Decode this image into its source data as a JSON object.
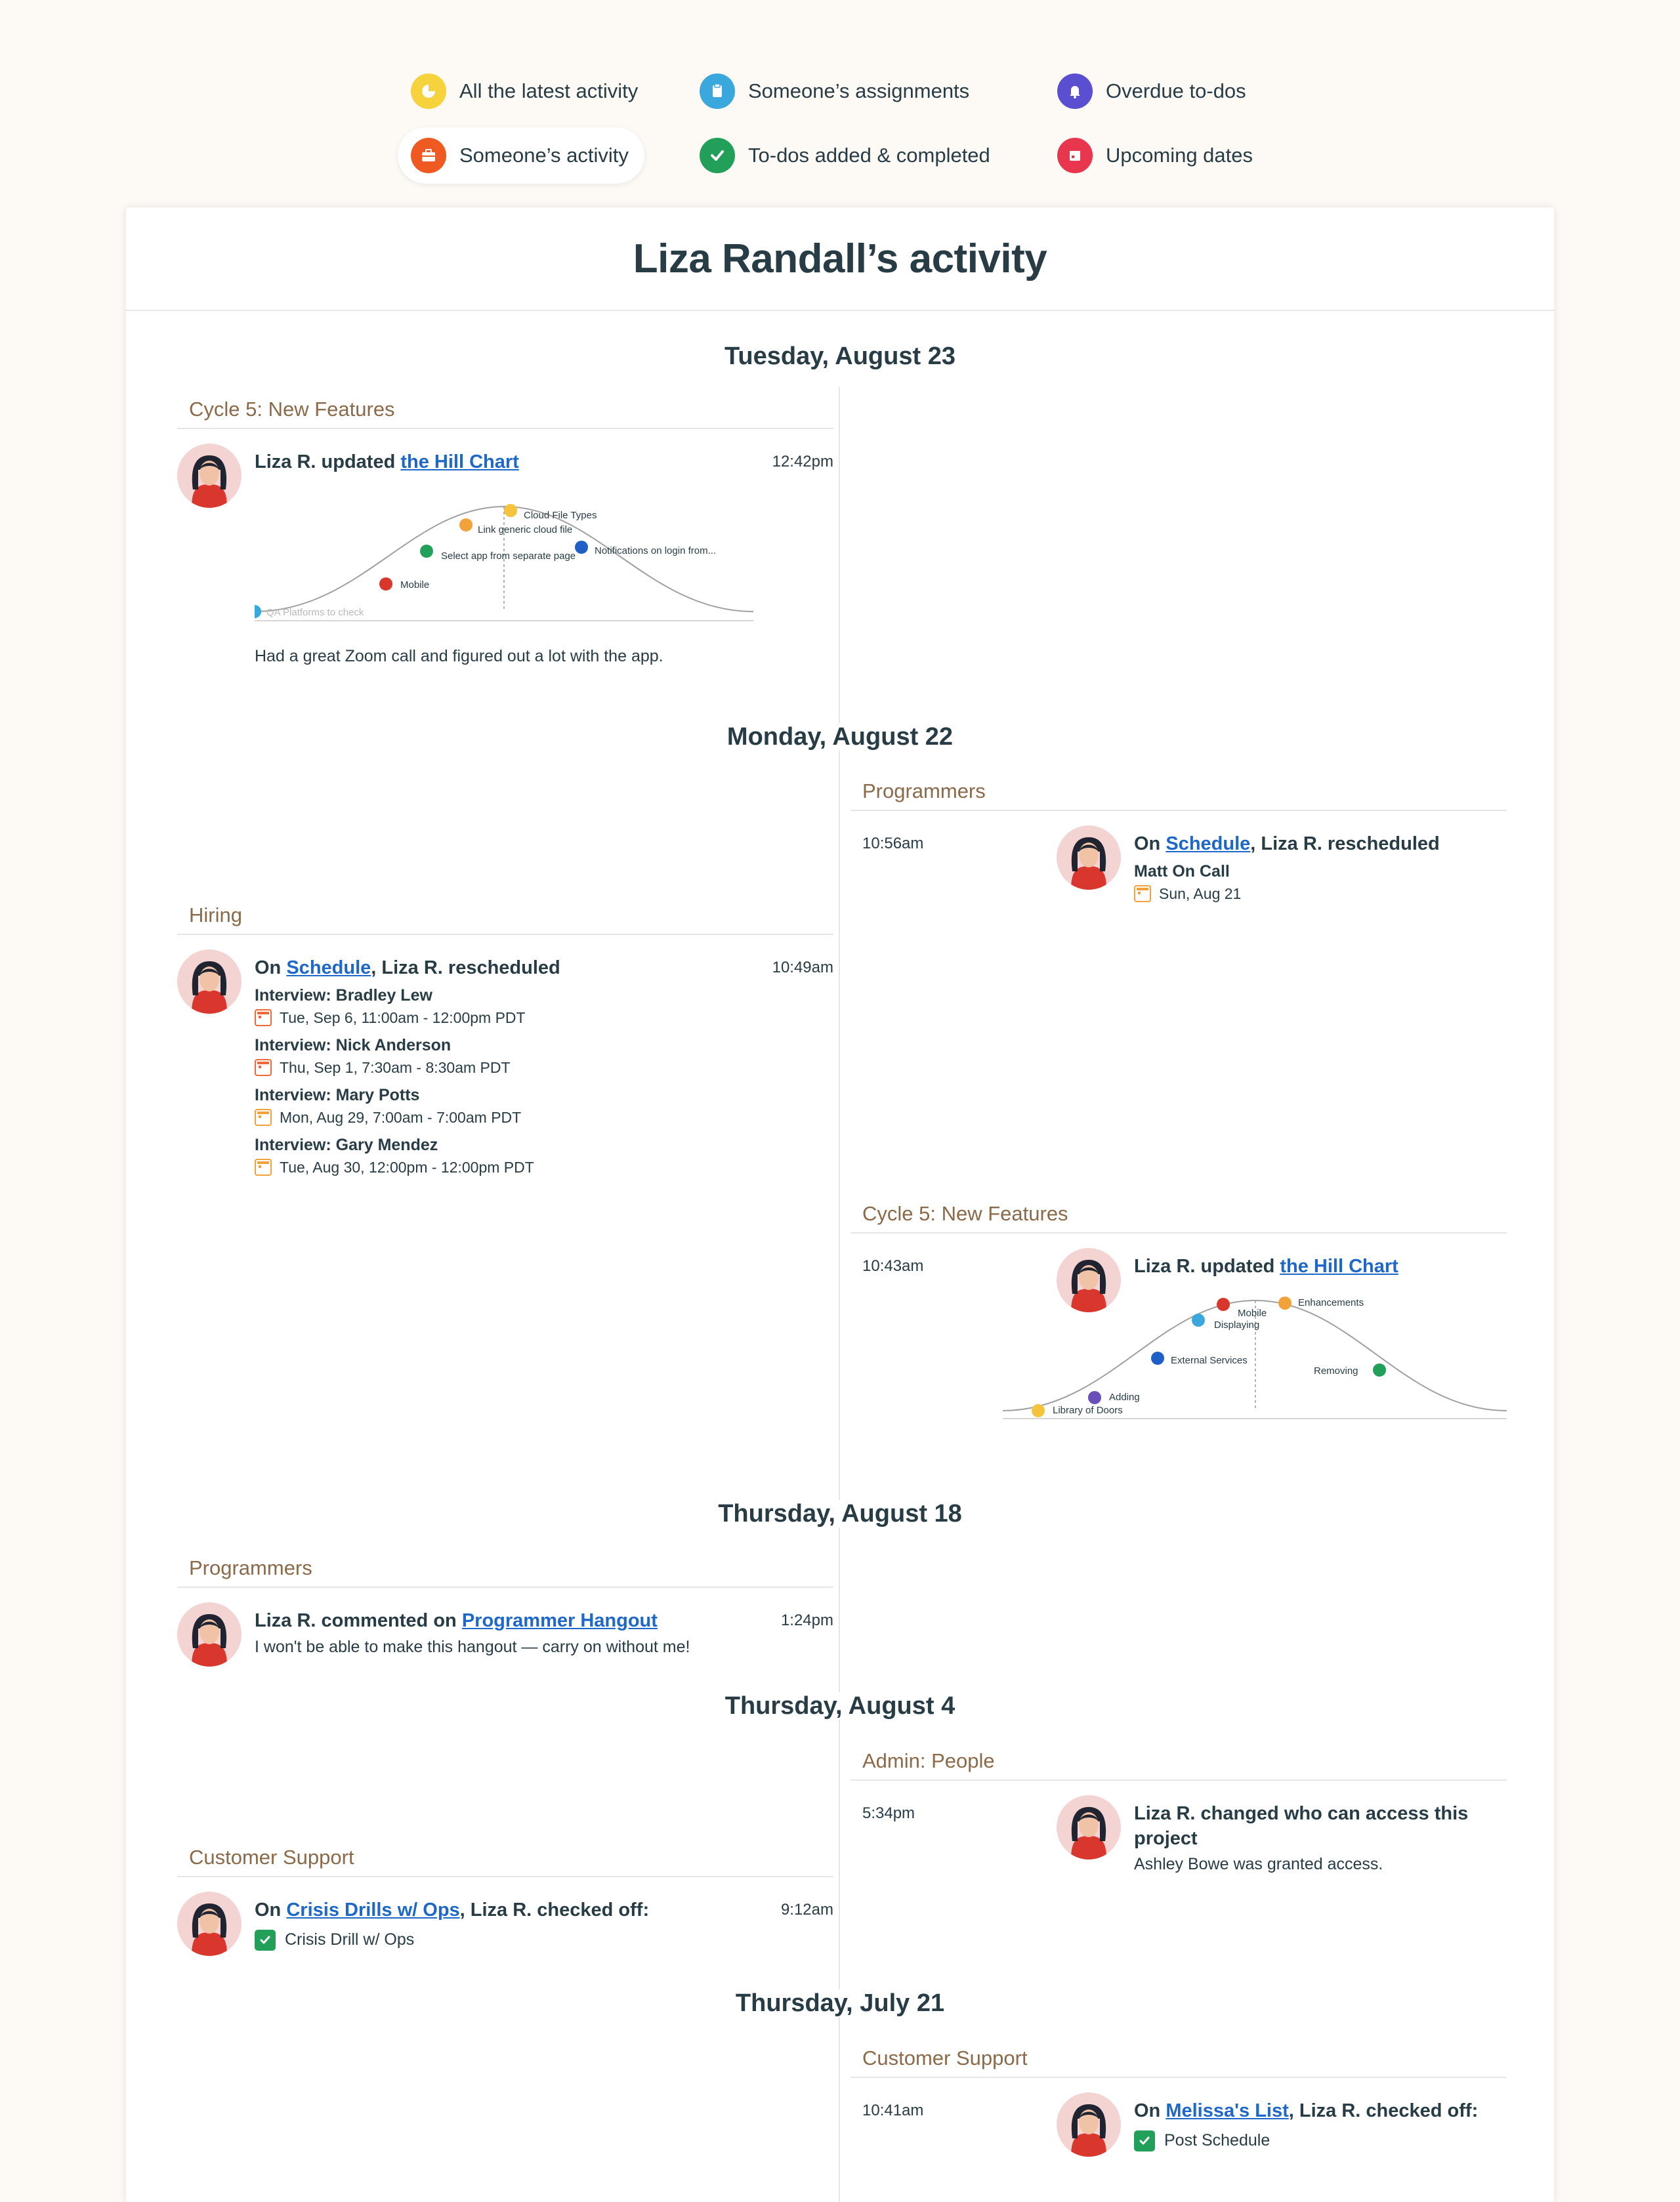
{
  "filters": [
    {
      "label": "All the latest activity",
      "icon": "clock-icon",
      "color": "#f6d33c"
    },
    {
      "label": "Someone’s assignments",
      "icon": "clipboard-icon",
      "color": "#3aa8dd"
    },
    {
      "label": "Overdue to-dos",
      "icon": "bell-icon",
      "color": "#5b4fd1"
    },
    {
      "label": "Someone’s activity",
      "icon": "briefcase-icon",
      "color": "#ef5a22"
    },
    {
      "label": "To-dos added & completed",
      "icon": "checkmark-icon",
      "color": "#22a05a"
    },
    {
      "label": "Upcoming dates",
      "icon": "calendar-icon",
      "color": "#e8364f"
    }
  ],
  "title": "Liza Randall’s activity",
  "dates": {
    "d1": "Tuesday, August 23",
    "d2": "Monday, August 22",
    "d3": "Thursday, August 18",
    "d4": "Thursday, August 4",
    "d5": "Thursday, July 21"
  },
  "entries": {
    "e1": {
      "project": "Cycle 5: New Features",
      "time": "12:42pm",
      "prefix": "Liza R. updated ",
      "link": "the Hill Chart",
      "note": "Had a great Zoom call and figured out a lot with the app.",
      "hill": [
        {
          "label": "QA Platforms to check",
          "color": "#3aa8dd"
        },
        {
          "label": "Mobile",
          "color": "#d9372d"
        },
        {
          "label": "Select app from separate page",
          "color": "#22a05a"
        },
        {
          "label": "Link generic cloud file",
          "color": "#f2a23a"
        },
        {
          "label": "Cloud File Types",
          "color": "#f6c33c"
        },
        {
          "label": "Notifications on login from...",
          "color": "#1d5fc7"
        }
      ]
    },
    "e2": {
      "project": "Programmers",
      "time": "10:56am",
      "prefix": "On ",
      "link": "Schedule",
      "suffix": ", Liza R. rescheduled",
      "events": [
        {
          "name": "Matt On Call",
          "date": "Sun, Aug 21"
        }
      ]
    },
    "e3": {
      "project": "Hiring",
      "time": "10:49am",
      "prefix": "On ",
      "link": "Schedule",
      "suffix": ", Liza R. rescheduled",
      "events": [
        {
          "name": "Interview: Bradley Lew",
          "date": "Tue, Sep 6, 11:00am - 12:00pm PDT"
        },
        {
          "name": "Interview: Nick Anderson",
          "date": "Thu, Sep 1, 7:30am - 8:30am PDT"
        },
        {
          "name": "Interview: Mary Potts",
          "date": "Mon, Aug 29, 7:00am - 7:00am PDT"
        },
        {
          "name": "Interview: Gary Mendez",
          "date": "Tue, Aug 30, 12:00pm - 12:00pm PDT"
        }
      ]
    },
    "e4": {
      "project": "Cycle 5: New Features",
      "time": "10:43am",
      "prefix": "Liza R. updated ",
      "link": "the Hill Chart",
      "hill": [
        {
          "label": "Library of Doors",
          "color": "#f6c33c"
        },
        {
          "label": "Adding",
          "color": "#6b4fb8"
        },
        {
          "label": "External Services",
          "color": "#1d5fc7"
        },
        {
          "label": "Displaying",
          "color": "#3aa8dd"
        },
        {
          "label": "Mobile",
          "color": "#d9372d"
        },
        {
          "label": "Enhancements",
          "color": "#f2a23a"
        },
        {
          "label": "Removing",
          "color": "#22a05a"
        }
      ]
    },
    "e5": {
      "project": "Programmers",
      "time": "1:24pm",
      "prefix": "Liza R. commented on ",
      "link": "Programmer Hangout",
      "comment": "I won't be able to make this hangout — carry on without me!"
    },
    "e6": {
      "project": "Admin: People",
      "time": "5:34pm",
      "headline": "Liza R. changed who can access this project",
      "sub": "Ashley Bowe was granted access."
    },
    "e7": {
      "project": "Customer Support",
      "time": "9:12am",
      "prefix": "On ",
      "link": "Crisis Drills w/ Ops",
      "suffix": ", Liza R. checked off:",
      "todo": "Crisis Drill w/ Ops"
    },
    "e8": {
      "project": "Customer Support",
      "time": "10:41am",
      "prefix": "On ",
      "link": "Melissa's List",
      "suffix": ", Liza R. checked off:",
      "todo": "Post Schedule"
    }
  }
}
